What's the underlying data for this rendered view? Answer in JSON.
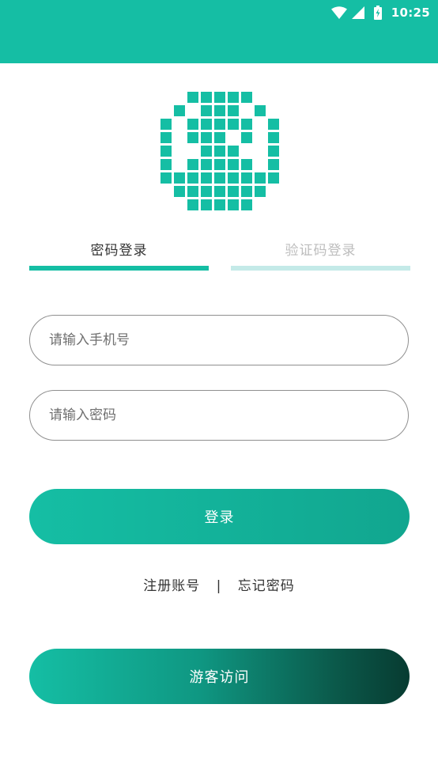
{
  "status_bar": {
    "time": "10:25",
    "icons": [
      "wifi-icon",
      "cell-signal-icon",
      "battery-charging-icon"
    ]
  },
  "colors": {
    "primary": "#15bea4",
    "tab_inactive_bar": "#c4eae8",
    "guest_gradient_end": "#073b31"
  },
  "logo": {
    "icon": "pixel-logo-icon"
  },
  "tabs": [
    {
      "label": "密码登录",
      "active": true
    },
    {
      "label": "验证码登录",
      "active": false
    }
  ],
  "form": {
    "phone_placeholder": "请输入手机号",
    "phone_value": "",
    "password_placeholder": "请输入密码",
    "password_value": ""
  },
  "buttons": {
    "login_label": "登录",
    "guest_label": "游客访问"
  },
  "links": {
    "register": "注册账号",
    "separator": "|",
    "forgot": "忘记密码"
  }
}
